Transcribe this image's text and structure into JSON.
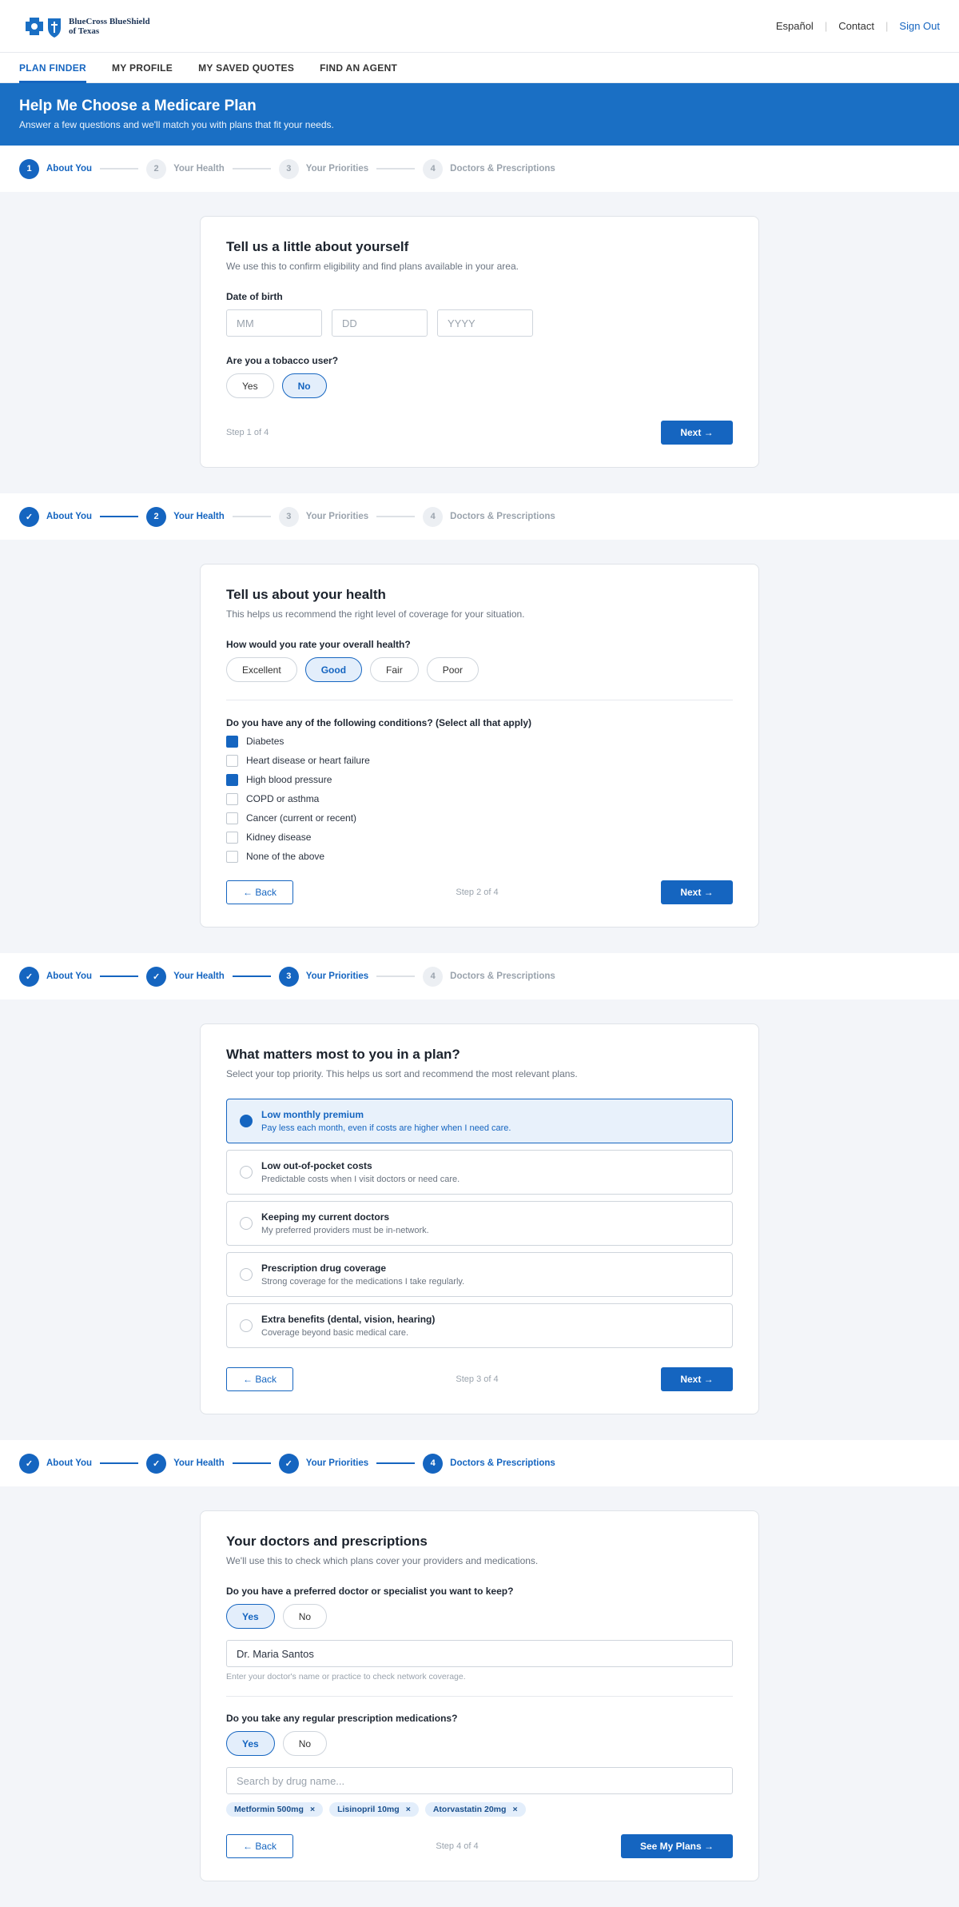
{
  "brand": {
    "name": "BlueCross BlueShield of Texas"
  },
  "header": {
    "links": {
      "espanol": "Español",
      "contact": "Contact",
      "signout": "Sign Out"
    }
  },
  "nav": [
    "PLAN FINDER",
    "MY PROFILE",
    "MY SAVED QUOTES",
    "FIND AN AGENT"
  ],
  "hero": {
    "title": "Help Me Choose a Medicare Plan",
    "subtitle": "Answer a few questions and we'll match you with plans that fit your needs."
  },
  "steps": [
    "About You",
    "Your Health",
    "Your Priorities",
    "Doctors & Prescriptions"
  ],
  "check_glyph": "✓",
  "buttons": {
    "next": "Next →",
    "back": "← Back",
    "see_plans": "See My Plans →"
  },
  "step1": {
    "title": "Tell us a little about yourself",
    "subtitle": "We use this to confirm eligibility and find plans available in your area.",
    "dob_label": "Date of birth",
    "dob_placeholders": [
      "MM",
      "DD",
      "YYYY"
    ],
    "tobacco_label": "Are you a tobacco user?",
    "tobacco_options": [
      "Yes",
      "No"
    ],
    "tobacco_selected": "No",
    "step_text": "Step 1 of 4"
  },
  "step2": {
    "title": "Tell us about your health",
    "subtitle": "This helps us recommend the right level of coverage for your situation.",
    "rating_label": "How would you rate your overall health?",
    "rating_options": [
      "Excellent",
      "Good",
      "Fair",
      "Poor"
    ],
    "rating_selected": "Good",
    "conditions_label": "Do you have any of the following conditions? (Select all that apply)",
    "conditions": [
      {
        "label": "Diabetes",
        "checked": true
      },
      {
        "label": "Heart disease or heart failure",
        "checked": false
      },
      {
        "label": "High blood pressure",
        "checked": true
      },
      {
        "label": "COPD or asthma",
        "checked": false
      },
      {
        "label": "Cancer (current or recent)",
        "checked": false
      },
      {
        "label": "Kidney disease",
        "checked": false
      },
      {
        "label": "None of the above",
        "checked": false
      }
    ],
    "step_text": "Step 2 of 4"
  },
  "step3": {
    "title": "What matters most to you in a plan?",
    "subtitle": "Select your top priority. This helps us sort and recommend the most relevant plans.",
    "options": [
      {
        "title": "Low monthly premium",
        "desc": "Pay less each month, even if costs are higher when I need care.",
        "selected": true
      },
      {
        "title": "Low out-of-pocket costs",
        "desc": "Predictable costs when I visit doctors or need care.",
        "selected": false
      },
      {
        "title": "Keeping my current doctors",
        "desc": "My preferred providers must be in-network.",
        "selected": false
      },
      {
        "title": "Prescription drug coverage",
        "desc": "Strong coverage for the medications I take regularly.",
        "selected": false
      },
      {
        "title": "Extra benefits (dental, vision, hearing)",
        "desc": "Coverage beyond basic medical care.",
        "selected": false
      }
    ],
    "step_text": "Step 3 of 4"
  },
  "step4": {
    "title": "Your doctors and prescriptions",
    "subtitle": "We'll use this to check which plans cover your providers and medications.",
    "doctor_label": "Do you have a preferred doctor or specialist you want to keep?",
    "doctor_options": [
      "Yes",
      "No"
    ],
    "doctor_selected": "Yes",
    "doctor_value": "Dr. Maria Santos",
    "doctor_hint": "Enter your doctor's name or practice to check network coverage.",
    "rx_label": "Do you take any regular prescription medications?",
    "rx_options": [
      "Yes",
      "No"
    ],
    "rx_selected": "Yes",
    "rx_placeholder": "Search by drug name...",
    "drugs": [
      "Metformin 500mg",
      "Lisinopril 10mg",
      "Atorvastatin 20mg"
    ],
    "chip_remove": "×",
    "step_text": "Step 4 of 4"
  }
}
